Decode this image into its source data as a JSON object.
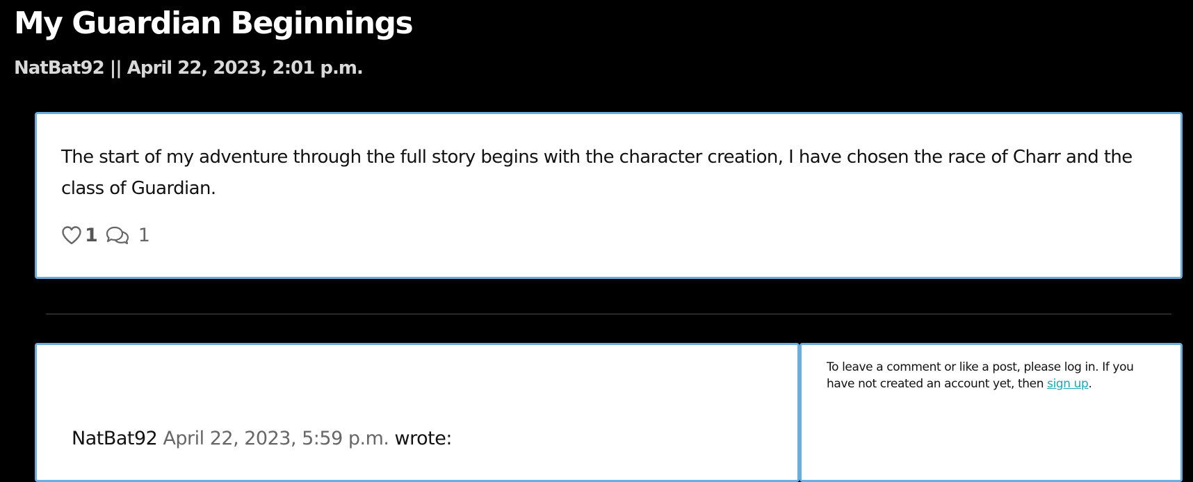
{
  "post": {
    "title": "My Guardian Beginnings",
    "meta": "NatBat92 || April 22, 2023, 2:01 p.m.",
    "body": "The start of my adventure through the full story begins with the character creation, I have chosen the race of Charr and the class of Guardian.",
    "likes": "1",
    "comments": "1",
    "icons": {
      "like": "heart-icon",
      "comment": "comment-bubbles-icon"
    }
  },
  "comments": [
    {
      "author": "NatBat92",
      "date": "April 22, 2023, 5:59 p.m.",
      "wrote": "wrote:"
    }
  ],
  "login_notice": {
    "text_before": "To leave a comment or like a post, please log in. If you have not created an account yet, then ",
    "link_label": "sign up",
    "text_after": "."
  },
  "colors": {
    "background": "#000000",
    "card_border": "#6aaee0",
    "link": "#1aa8b8",
    "muted_text": "#666666"
  }
}
